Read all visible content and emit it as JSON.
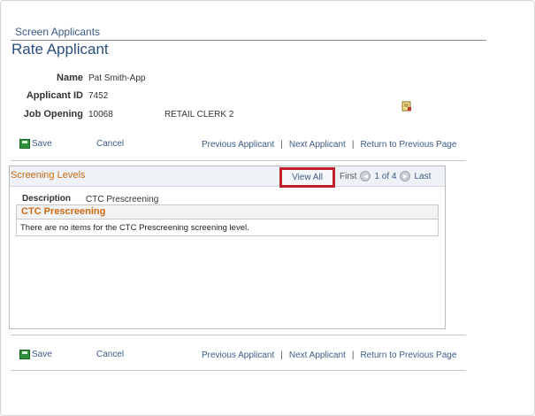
{
  "page": {
    "breadcrumb": "Screen Applicants",
    "title": "Rate Applicant"
  },
  "applicant": {
    "name_label": "Name",
    "name_value": "Pat Smith-App",
    "id_label": "Applicant ID",
    "id_value": "7452",
    "job_label": "Job Opening",
    "job_value": "10068",
    "job_title": "RETAIL CLERK 2"
  },
  "icons": {
    "notes": "notes-icon",
    "save": "save-icon",
    "previous": "arrow-left-circle-icon",
    "next": "arrow-right-circle-icon"
  },
  "toolbar": {
    "save_label": "Save",
    "cancel_label": "Cancel",
    "previous_applicant": "Previous Applicant",
    "separator": "|",
    "next_applicant": "Next Applicant",
    "return_label": "Return to Previous Page"
  },
  "screening": {
    "title": "Screening Levels",
    "view_all": "View All",
    "first": "First",
    "count": "1 of 4",
    "last": "Last",
    "description_label": "Description",
    "description_value": "CTC Prescreening",
    "grid_title": "CTC Prescreening",
    "empty_message": "There are no items for the CTC Prescreening screening level."
  },
  "colors": {
    "link": "#3b5b87",
    "section_title": "#cc6a12",
    "highlight_border": "#c0202a"
  }
}
